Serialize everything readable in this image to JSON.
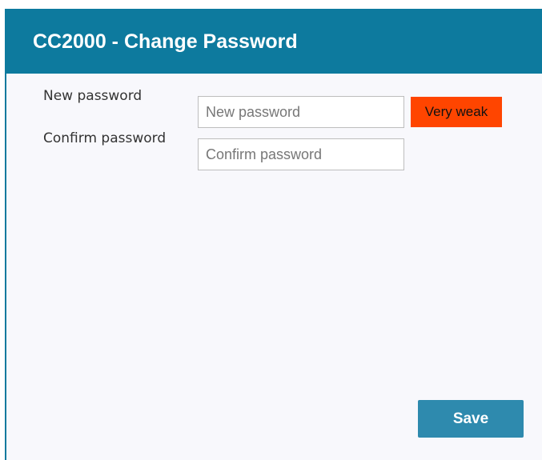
{
  "header": {
    "title": "CC2000 - Change Password"
  },
  "form": {
    "new_password": {
      "label": "New password",
      "placeholder": "New password",
      "value": ""
    },
    "confirm_password": {
      "label": "Confirm password",
      "placeholder": "Confirm password",
      "value": ""
    },
    "strength": {
      "text": "Very weak",
      "color": "#ff4500"
    }
  },
  "actions": {
    "save_label": "Save"
  },
  "colors": {
    "header_background": "#0d7a9e",
    "button_background": "#2e8aae",
    "dialog_background": "#f8f8fc"
  }
}
